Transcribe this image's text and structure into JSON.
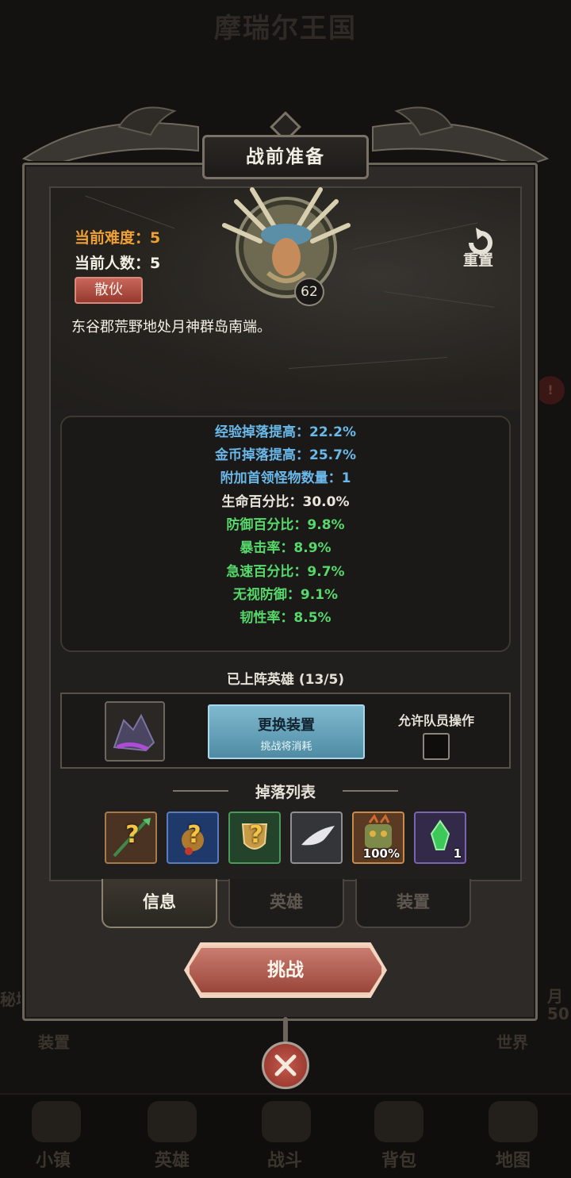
{
  "background": {
    "kingdom_title": "摩瑞尔王国",
    "left_label": "装置",
    "right_label": "世界",
    "left_edge_text": "秘境",
    "right_edge_text": "月",
    "right_edge_num": "50",
    "nav": [
      "小镇",
      "英雄",
      "战斗",
      "背包",
      "地图"
    ]
  },
  "modal": {
    "title": "战前准备",
    "difficulty_label": "当前难度：",
    "difficulty_value": "5",
    "members_label": "当前人数：",
    "members_value": "5",
    "disband_label": "散伙",
    "reset_label": "重置",
    "description": "东谷郡荒野地处月神群岛南端。",
    "boss_level": "62"
  },
  "stats": [
    {
      "text": "经验掉落提高：22.2%",
      "color": "#6ab8ea"
    },
    {
      "text": "金币掉落提高：25.7%",
      "color": "#6ab8ea"
    },
    {
      "text": "附加首领怪物数量：1",
      "color": "#6ab8ea"
    },
    {
      "text": "生命百分比：30.0%",
      "color": "#e9e6de"
    },
    {
      "text": "防御百分比：9.8%",
      "color": "#56d86a"
    },
    {
      "text": "暴击率：8.9%",
      "color": "#56d86a"
    },
    {
      "text": "急速百分比：9.7%",
      "color": "#56d86a"
    },
    {
      "text": "无视防御：9.1%",
      "color": "#56d86a"
    },
    {
      "text": "韧性率：8.5%",
      "color": "#56d86a"
    }
  ],
  "heroes_deployed": "已上阵英雄 (13/5)",
  "equip": {
    "change_button": "更换装置",
    "change_sub": "挑战将消耗",
    "allow_label": "允许队员操作"
  },
  "drops": {
    "title": "掉落列表",
    "items": [
      {
        "icon": "spear-icon",
        "tag": ""
      },
      {
        "icon": "mystery-amulet-icon",
        "tag": ""
      },
      {
        "icon": "mystery-shield-icon",
        "tag": ""
      },
      {
        "icon": "wing-icon",
        "tag": ""
      },
      {
        "icon": "totem-icon",
        "tag": "100%"
      },
      {
        "icon": "green-crystal-icon",
        "tag": "1"
      }
    ]
  },
  "tabs": [
    {
      "label": "信息",
      "active": true
    },
    {
      "label": "英雄",
      "active": false
    },
    {
      "label": "装置",
      "active": false
    }
  ],
  "challenge_label": "挑战",
  "colors": {
    "accent_orange": "#f0a033",
    "stat_blue": "#6ab8ea",
    "stat_green": "#56d86a",
    "button_red": "#c97c6f",
    "button_teal": "#7fb9cf"
  }
}
